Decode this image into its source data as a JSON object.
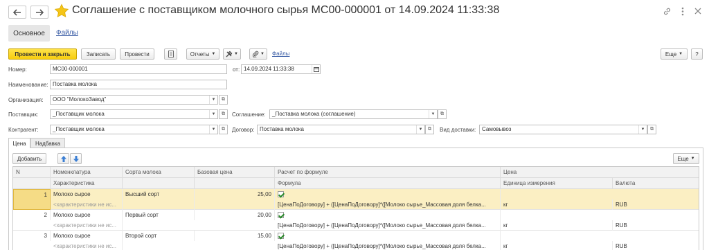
{
  "window": {
    "title": "Соглашение с поставщиком молочного сырья МС00-000001 от 14.09.2024 11:33:38"
  },
  "sections": {
    "main": "Основное",
    "files": "Файлы"
  },
  "toolbar": {
    "post_close": "Провести и закрыть",
    "save": "Записать",
    "post": "Провести",
    "reports": "Отчеты",
    "files_link": "Файлы",
    "more": "Еще",
    "help": "?"
  },
  "form": {
    "number_label": "Номер:",
    "number_value": "МС00-000001",
    "date_label": "от:",
    "date_value": "14.09.2024 11:33:38",
    "name_label": "Наименование:",
    "name_value": "Поставка молока",
    "org_label": "Организация:",
    "org_value": "ООО \"МолокоЗавод\"",
    "supplier_label": "Поставщик:",
    "supplier_value": "_Поставщик молока",
    "agreement_label": "Соглашение:",
    "agreement_value": "_Поставка молока (соглашение)",
    "counterparty_label": "Контрагент:",
    "counterparty_value": "_Поставщик молока",
    "contract_label": "Договор:",
    "contract_value": "Поставка молока",
    "delivery_label": "Вид доставки:",
    "delivery_value": "Самовывоз"
  },
  "tabs": [
    "Цена",
    "Надбавка"
  ],
  "table_toolbar": {
    "add": "Добавить",
    "more": "Еще"
  },
  "table": {
    "headers_top": [
      "N",
      "Номенклатура",
      "Сорта молока",
      "Базовая цена",
      "Расчет по формуле",
      "Цена"
    ],
    "headers_bottom": [
      "Характеристика",
      "Формула",
      "Единица измерения",
      "Валюта"
    ],
    "rows": [
      {
        "n": "1",
        "item": "Молоко сырое",
        "char": "<характеристики не ис...",
        "grade": "Высший сорт",
        "base_price": "25,00",
        "formula": "[ЦенаПоДоговору] + ([ЦенаПоДоговору]*([Молоко сырье_Массовая доля белка...",
        "unit": "кг",
        "currency": "RUB"
      },
      {
        "n": "2",
        "item": "Молоко сырое",
        "char": "<характеристики не ис...",
        "grade": "Первый сорт",
        "base_price": "20,00",
        "formula": "[ЦенаПоДоговору] + ([ЦенаПоДоговору]*([Молоко сырье_Массовая доля белка...",
        "unit": "кг",
        "currency": "RUB"
      },
      {
        "n": "3",
        "item": "Молоко сырое",
        "char": "<характеристики не ис...",
        "grade": "Второй сорт",
        "base_price": "15,00",
        "formula": "[ЦенаПоДоговору] + ([ЦенаПоДоговору]*([Молоко сырье_Массовая доля белка...",
        "unit": "кг",
        "currency": "RUB"
      }
    ]
  },
  "colors": {
    "accent_yellow": "#f7cd0e",
    "star": "#f5c518",
    "link": "#3b5ea6",
    "selected_row": "#fbefc3"
  }
}
